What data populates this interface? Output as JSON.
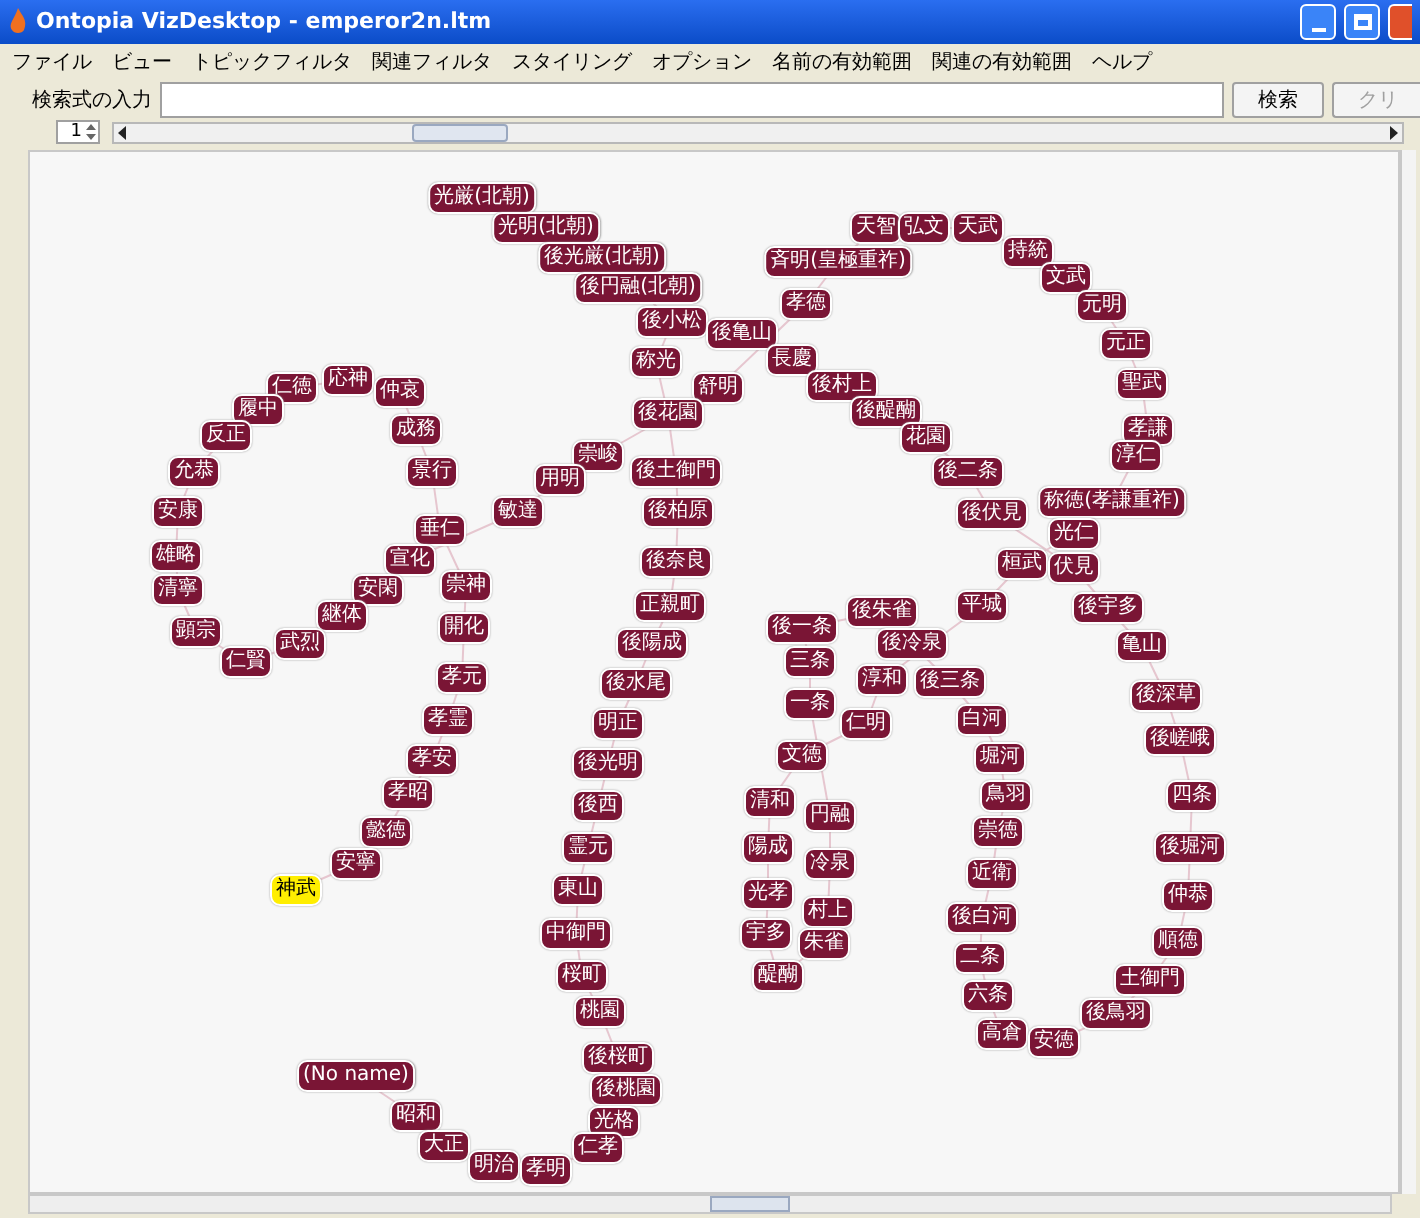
{
  "window": {
    "title": "Ontopia VizDesktop - emperor2n.ltm"
  },
  "menu": [
    "ファイル",
    "ビュー",
    "トピックフィルタ",
    "関連フィルタ",
    "スタイリング",
    "オプション",
    "名前の有効範囲",
    "関連の有効範囲",
    "ヘルプ"
  ],
  "search": {
    "label": "検索式の入力",
    "search_button": "検索",
    "clear_button": {
      "label": "クリ",
      "disabled": true
    }
  },
  "locality": {
    "value": "1"
  },
  "zoom_slider": {
    "level": 0.24
  },
  "nodes": [
    {
      "label": "光厳(北朝)",
      "selected": false
    },
    {
      "label": "光明(北朝)",
      "selected": false
    },
    {
      "label": "天智",
      "selected": false
    },
    {
      "label": "弘文",
      "selected": false
    },
    {
      "label": "天武",
      "selected": false
    },
    {
      "label": "後光厳(北朝)",
      "selected": false
    },
    {
      "label": "斉明(皇極重祚)",
      "selected": false
    },
    {
      "label": "持統",
      "selected": false
    },
    {
      "label": "後円融(北朝)",
      "selected": false
    },
    {
      "label": "文武",
      "selected": false
    },
    {
      "label": "孝徳",
      "selected": false
    },
    {
      "label": "元明",
      "selected": false
    },
    {
      "label": "後小松",
      "selected": false
    },
    {
      "label": "後亀山",
      "selected": false
    },
    {
      "label": "元正",
      "selected": false
    },
    {
      "label": "称光",
      "selected": false
    },
    {
      "label": "長慶",
      "selected": false
    },
    {
      "label": "仁徳",
      "selected": false
    },
    {
      "label": "応神",
      "selected": false
    },
    {
      "label": "仲哀",
      "selected": false
    },
    {
      "label": "舒明",
      "selected": false
    },
    {
      "label": "後村上",
      "selected": false
    },
    {
      "label": "聖武",
      "selected": false
    },
    {
      "label": "履中",
      "selected": false
    },
    {
      "label": "後花園",
      "selected": false
    },
    {
      "label": "後醍醐",
      "selected": false
    },
    {
      "label": "反正",
      "selected": false
    },
    {
      "label": "成務",
      "selected": false
    },
    {
      "label": "花園",
      "selected": false
    },
    {
      "label": "孝謙",
      "selected": false
    },
    {
      "label": "崇峻",
      "selected": false
    },
    {
      "label": "淳仁",
      "selected": false
    },
    {
      "label": "允恭",
      "selected": false
    },
    {
      "label": "景行",
      "selected": false
    },
    {
      "label": "用明",
      "selected": false
    },
    {
      "label": "後土御門",
      "selected": false
    },
    {
      "label": "後二条",
      "selected": false
    },
    {
      "label": "安康",
      "selected": false
    },
    {
      "label": "敏達",
      "selected": false
    },
    {
      "label": "後柏原",
      "selected": false
    },
    {
      "label": "後伏見",
      "selected": false
    },
    {
      "label": "称徳(孝謙重祚)",
      "selected": false
    },
    {
      "label": "垂仁",
      "selected": false
    },
    {
      "label": "光仁",
      "selected": false
    },
    {
      "label": "雄略",
      "selected": false
    },
    {
      "label": "宣化",
      "selected": false
    },
    {
      "label": "後奈良",
      "selected": false
    },
    {
      "label": "桓武",
      "selected": false
    },
    {
      "label": "伏見",
      "selected": false
    },
    {
      "label": "清寧",
      "selected": false
    },
    {
      "label": "安閑",
      "selected": false
    },
    {
      "label": "崇神",
      "selected": false
    },
    {
      "label": "継体",
      "selected": false
    },
    {
      "label": "正親町",
      "selected": false
    },
    {
      "label": "後朱雀",
      "selected": false
    },
    {
      "label": "平城",
      "selected": false
    },
    {
      "label": "後宇多",
      "selected": false
    },
    {
      "label": "顕宗",
      "selected": false
    },
    {
      "label": "開化",
      "selected": false
    },
    {
      "label": "後一条",
      "selected": false
    },
    {
      "label": "武烈",
      "selected": false
    },
    {
      "label": "後陽成",
      "selected": false
    },
    {
      "label": "後冷泉",
      "selected": false
    },
    {
      "label": "亀山",
      "selected": false
    },
    {
      "label": "仁賢",
      "selected": false
    },
    {
      "label": "三条",
      "selected": false
    },
    {
      "label": "孝元",
      "selected": false
    },
    {
      "label": "後水尾",
      "selected": false
    },
    {
      "label": "淳和",
      "selected": false
    },
    {
      "label": "後三条",
      "selected": false
    },
    {
      "label": "一条",
      "selected": false
    },
    {
      "label": "後深草",
      "selected": false
    },
    {
      "label": "孝霊",
      "selected": false
    },
    {
      "label": "明正",
      "selected": false
    },
    {
      "label": "仁明",
      "selected": false
    },
    {
      "label": "白河",
      "selected": false
    },
    {
      "label": "後嵯峨",
      "selected": false
    },
    {
      "label": "孝安",
      "selected": false
    },
    {
      "label": "後光明",
      "selected": false
    },
    {
      "label": "文徳",
      "selected": false
    },
    {
      "label": "堀河",
      "selected": false
    },
    {
      "label": "孝昭",
      "selected": false
    },
    {
      "label": "後西",
      "selected": false
    },
    {
      "label": "清和",
      "selected": false
    },
    {
      "label": "鳥羽",
      "selected": false
    },
    {
      "label": "四条",
      "selected": false
    },
    {
      "label": "円融",
      "selected": false
    },
    {
      "label": "懿徳",
      "selected": false
    },
    {
      "label": "崇徳",
      "selected": false
    },
    {
      "label": "霊元",
      "selected": false
    },
    {
      "label": "陽成",
      "selected": false
    },
    {
      "label": "後堀河",
      "selected": false
    },
    {
      "label": "安寧",
      "selected": false
    },
    {
      "label": "冷泉",
      "selected": false
    },
    {
      "label": "近衛",
      "selected": false
    },
    {
      "label": "神武",
      "selected": true
    },
    {
      "label": "東山",
      "selected": false
    },
    {
      "label": "光孝",
      "selected": false
    },
    {
      "label": "仲恭",
      "selected": false
    },
    {
      "label": "村上",
      "selected": false
    },
    {
      "label": "後白河",
      "selected": false
    },
    {
      "label": "中御門",
      "selected": false
    },
    {
      "label": "宇多",
      "selected": false
    },
    {
      "label": "朱雀",
      "selected": false
    },
    {
      "label": "順徳",
      "selected": false
    },
    {
      "label": "二条",
      "selected": false
    },
    {
      "label": "桜町",
      "selected": false
    },
    {
      "label": "醍醐",
      "selected": false
    },
    {
      "label": "土御門",
      "selected": false
    },
    {
      "label": "六条",
      "selected": false
    },
    {
      "label": "桃園",
      "selected": false
    },
    {
      "label": "後鳥羽",
      "selected": false
    },
    {
      "label": "高倉",
      "selected": false
    },
    {
      "label": "安徳",
      "selected": false
    },
    {
      "label": "後桜町",
      "selected": false
    },
    {
      "label": "(No name)",
      "selected": false
    },
    {
      "label": "後桃園",
      "selected": false
    },
    {
      "label": "昭和",
      "selected": false
    },
    {
      "label": "光格",
      "selected": false
    },
    {
      "label": "大正",
      "selected": false
    },
    {
      "label": "仁孝",
      "selected": false
    },
    {
      "label": "明治",
      "selected": false
    },
    {
      "label": "孝明",
      "selected": false
    }
  ]
}
